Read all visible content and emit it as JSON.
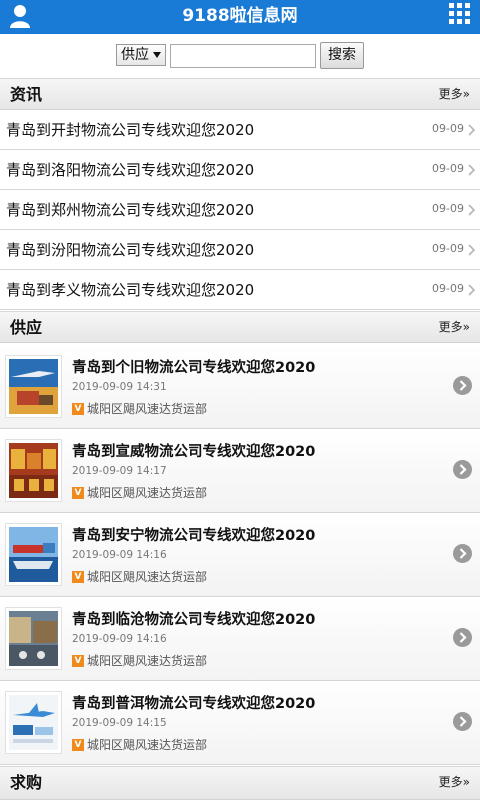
{
  "header": {
    "title": "9188啦信息网",
    "user_icon": "user-icon",
    "menu_icon": "grid-menu-icon",
    "color": "#1a7bd6"
  },
  "search": {
    "category": "供应",
    "placeholder": "",
    "button": "搜索"
  },
  "news": {
    "title": "资讯",
    "more": "更多»",
    "items": [
      {
        "title": "青岛到开封物流公司专线欢迎您2020",
        "date": "09-09"
      },
      {
        "title": "青岛到洛阳物流公司专线欢迎您2020",
        "date": "09-09"
      },
      {
        "title": "青岛到郑州物流公司专线欢迎您2020",
        "date": "09-09"
      },
      {
        "title": "青岛到汾阳物流公司专线欢迎您2020",
        "date": "09-09"
      },
      {
        "title": "青岛到孝义物流公司专线欢迎您2020",
        "date": "09-09"
      }
    ]
  },
  "supply": {
    "title": "供应",
    "more": "更多»",
    "items": [
      {
        "title": "青岛到个旧物流公司专线欢迎您2020",
        "time": "2019-09-09 14:31",
        "badge": "V",
        "company": "城阳区飓风速达货运部"
      },
      {
        "title": "青岛到宣威物流公司专线欢迎您2020",
        "time": "2019-09-09 14:17",
        "badge": "V",
        "company": "城阳区飓风速达货运部"
      },
      {
        "title": "青岛到安宁物流公司专线欢迎您2020",
        "time": "2019-09-09 14:16",
        "badge": "V",
        "company": "城阳区飓风速达货运部"
      },
      {
        "title": "青岛到临沧物流公司专线欢迎您2020",
        "time": "2019-09-09 14:16",
        "badge": "V",
        "company": "城阳区飓风速达货运部"
      },
      {
        "title": "青岛到普洱物流公司专线欢迎您2020",
        "time": "2019-09-09 14:15",
        "badge": "V",
        "company": "城阳区飓风速达货运部"
      }
    ]
  },
  "purchase": {
    "title": "求购",
    "more": "更多»"
  }
}
